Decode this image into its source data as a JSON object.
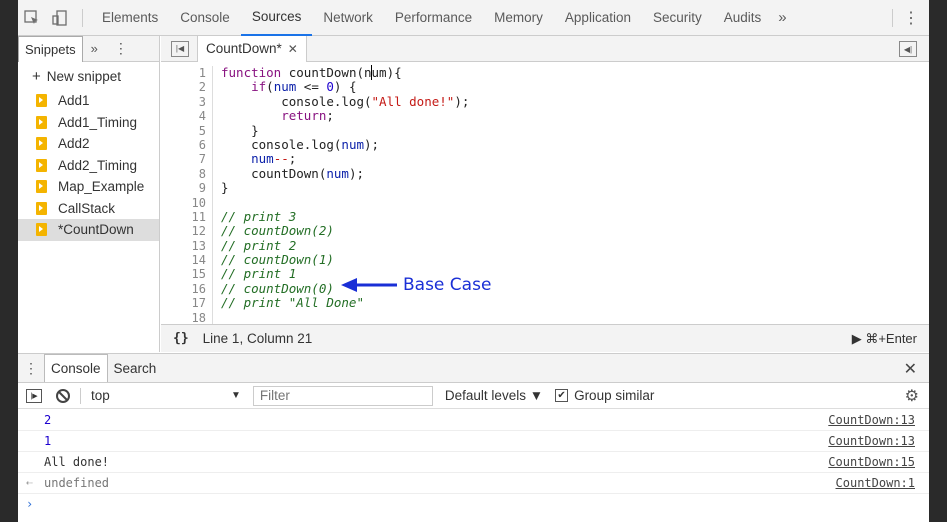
{
  "topbar": {
    "tabs": [
      "Elements",
      "Console",
      "Sources",
      "Network",
      "Performance",
      "Memory",
      "Application",
      "Security",
      "Audits"
    ],
    "active_tab": "Sources",
    "more": "»"
  },
  "snippets": {
    "tab_label": "Snippets",
    "more": "»",
    "new_snippet": "New snippet",
    "items": [
      "Add1",
      "Add1_Timing",
      "Add2",
      "Add2_Timing",
      "Map_Example",
      "CallStack",
      "*CountDown"
    ],
    "selected": "*CountDown"
  },
  "editor": {
    "file_tab": "CountDown*",
    "line_numbers": [
      "1",
      "2",
      "3",
      "4",
      "5",
      "6",
      "7",
      "8",
      "9",
      "10",
      "11",
      "12",
      "13",
      "14",
      "15",
      "16",
      "17",
      "18"
    ],
    "annotation": "Base Case",
    "status_position": "Line 1, Column 21",
    "status_run": "▶ ⌘+Enter"
  },
  "drawer": {
    "tabs": [
      "Console",
      "Search"
    ],
    "active_tab": "Console"
  },
  "console_toolbar": {
    "context": "top",
    "filter_placeholder": "Filter",
    "levels": "Default levels ▼",
    "group_similar": "Group similar"
  },
  "console_rows": [
    {
      "text": "2",
      "source": "CountDown:13"
    },
    {
      "text": "1",
      "source": "CountDown:13"
    },
    {
      "text": "All done!",
      "source": "CountDown:15"
    },
    {
      "text": "undefined",
      "source": "CountDown:1"
    }
  ],
  "colors": {
    "accent": "#1a73e8",
    "annotation": "#1a2fd6",
    "snippet_icon": "#f4b400"
  }
}
